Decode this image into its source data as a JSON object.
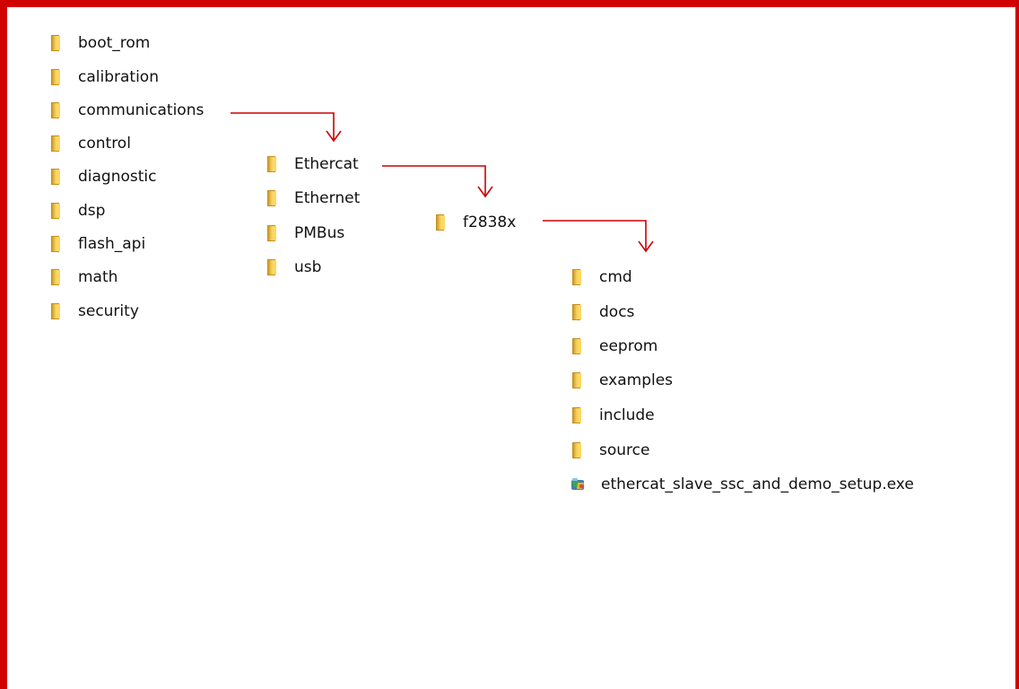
{
  "root_folders": [
    {
      "label": "boot_rom",
      "icon": "folder-icon"
    },
    {
      "label": "calibration",
      "icon": "folder-icon"
    },
    {
      "label": "communications",
      "icon": "folder-icon"
    },
    {
      "label": "control",
      "icon": "folder-icon"
    },
    {
      "label": "diagnostic",
      "icon": "folder-icon"
    },
    {
      "label": "dsp",
      "icon": "folder-icon"
    },
    {
      "label": "flash_api",
      "icon": "folder-icon"
    },
    {
      "label": "math",
      "icon": "folder-icon"
    },
    {
      "label": "security",
      "icon": "folder-icon"
    }
  ],
  "communications_folders": [
    {
      "label": "Ethercat",
      "icon": "folder-icon"
    },
    {
      "label": "Ethernet",
      "icon": "folder-icon"
    },
    {
      "label": "PMBus",
      "icon": "folder-icon"
    },
    {
      "label": "usb",
      "icon": "folder-icon"
    }
  ],
  "ethercat_folders": [
    {
      "label": "f2838x",
      "icon": "folder-icon"
    }
  ],
  "f2838x_items": [
    {
      "label": "cmd",
      "icon": "folder-icon"
    },
    {
      "label": "docs",
      "icon": "folder-icon"
    },
    {
      "label": "eeprom",
      "icon": "folder-icon"
    },
    {
      "label": "examples",
      "icon": "folder-icon"
    },
    {
      "label": "include",
      "icon": "folder-icon"
    },
    {
      "label": "source",
      "icon": "folder-icon"
    },
    {
      "label": "ethercat_slave_ssc_and_demo_setup.exe",
      "icon": "installer-exe-icon"
    }
  ],
  "colors": {
    "frame_border": "#d10000",
    "arrow": "#cc0000",
    "folder_yellow": "#f0c64e"
  }
}
